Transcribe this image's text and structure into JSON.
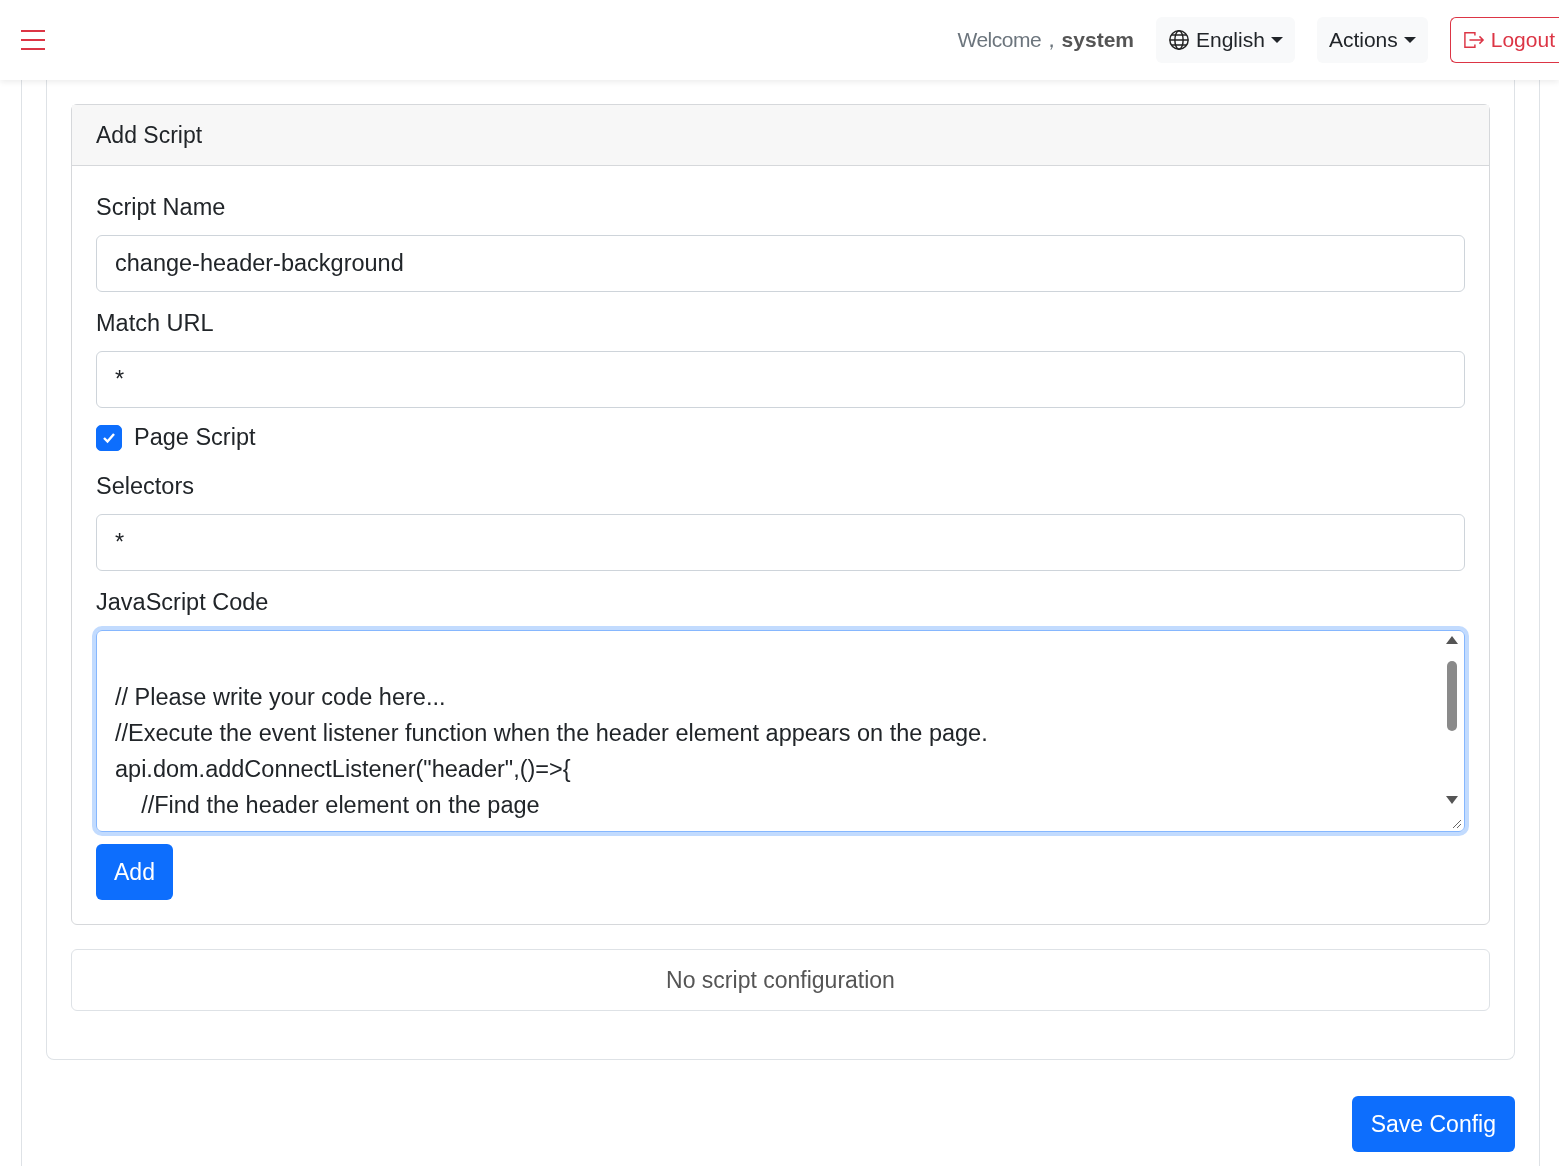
{
  "header": {
    "welcome": "Welcome，",
    "user": "system",
    "language": "English",
    "actions": "Actions",
    "logout": "Logout"
  },
  "add_script": {
    "title": "Add Script",
    "fields": [
      {
        "kind": "text",
        "label": "Script Name",
        "value": "change-header-background"
      },
      {
        "kind": "text",
        "label": "Match URL",
        "value": "*"
      },
      {
        "kind": "checkbox",
        "label": "Page Script",
        "checked": true
      },
      {
        "kind": "text",
        "label": "Selectors",
        "value": "*"
      },
      {
        "kind": "code",
        "label": "JavaScript Code",
        "lines": [
          "// Please write your code here...",
          "//Execute the event listener function when the header element appears on the page.",
          "api.dom.addConnectListener(\"header\",()=>{",
          "\t//Find the header element on the page"
        ]
      }
    ],
    "add_button": "Add"
  },
  "empty_message": "No script configuration",
  "save_button": "Save Config"
}
